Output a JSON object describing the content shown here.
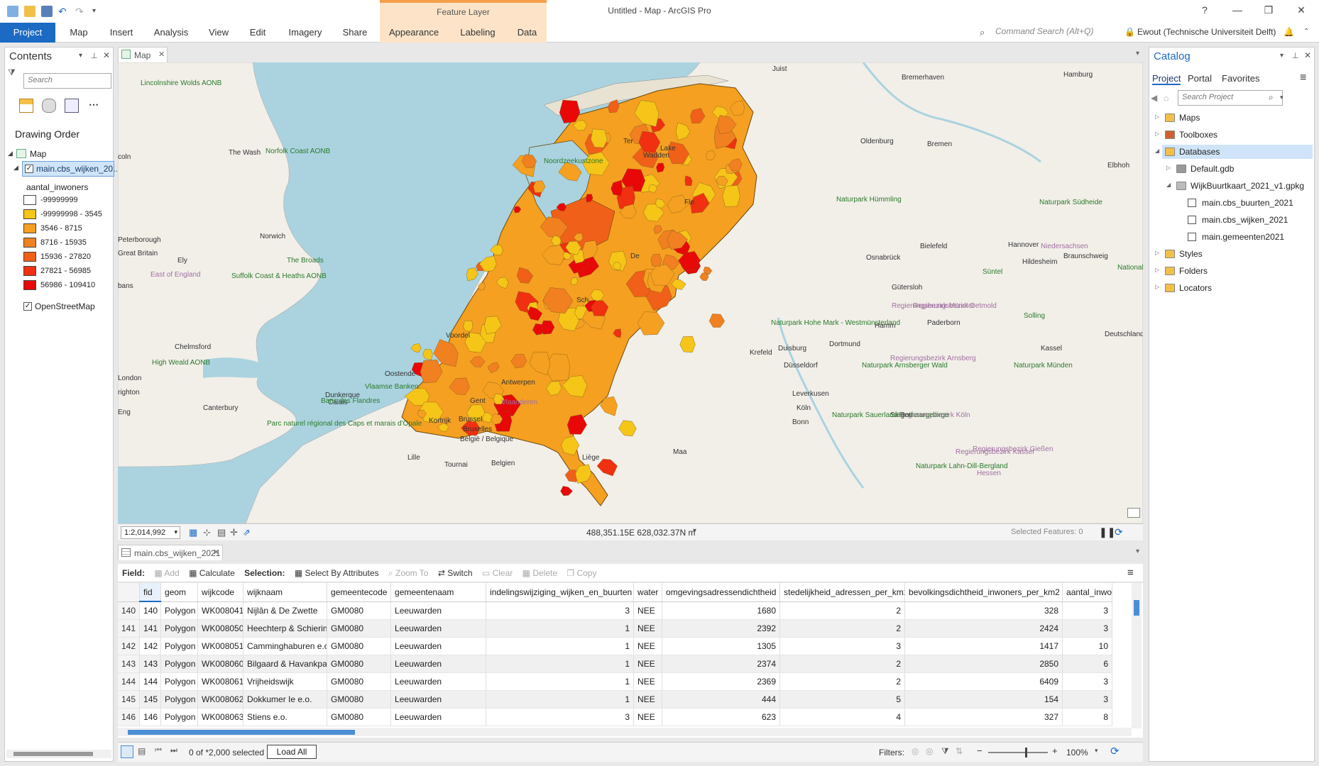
{
  "window": {
    "title": "Untitled - Map - ArcGIS Pro",
    "context_tab_header": "Feature Layer",
    "help": "?",
    "minimize": "—",
    "maximize": "❐",
    "close": "✕"
  },
  "ribbon": {
    "tabs": [
      "Project",
      "Map",
      "Insert",
      "Analysis",
      "View",
      "Edit",
      "Imagery",
      "Share",
      "Appearance",
      "Labeling",
      "Data"
    ],
    "command_search_placeholder": "Command Search (Alt+Q)",
    "user": "Ewout (Technische Universiteit Delft)"
  },
  "contents": {
    "title": "Contents",
    "search_placeholder": "Search",
    "section": "Drawing Order",
    "map_item": "Map",
    "layer_name": "main.cbs_wijken_20...",
    "field_name": "aantal_inwoners",
    "legend": [
      {
        "label": "-99999999",
        "color": "#ffffff"
      },
      {
        "label": "-99999998 - 3545",
        "color": "#f5c518"
      },
      {
        "label": "3546 - 8715",
        "color": "#f5a020"
      },
      {
        "label": "8716 - 15935",
        "color": "#f08020"
      },
      {
        "label": "15936 - 27820",
        "color": "#f06018"
      },
      {
        "label": "27821 - 56985",
        "color": "#f03010"
      },
      {
        "label": "56986 - 109410",
        "color": "#e80808"
      }
    ],
    "basemap": "OpenStreetMap"
  },
  "map": {
    "tab_label": "Map",
    "scale": "1:2,014,992",
    "coordinates": "488,351.15E 628,032.37N m",
    "selected_features": "Selected Features: 0",
    "place_labels": [
      {
        "text": "Bremerhaven"
      },
      {
        "text": "Hamburg"
      },
      {
        "text": "Oldenburg"
      },
      {
        "text": "Bremen"
      },
      {
        "text": "Hannover"
      },
      {
        "text": "Osnabrück"
      },
      {
        "text": "Bielefeld"
      },
      {
        "text": "Hildesheim"
      },
      {
        "text": "Braunschweig"
      },
      {
        "text": "Gütersloh"
      },
      {
        "text": "Paderborn"
      },
      {
        "text": "Hamm"
      },
      {
        "text": "Dortmund"
      },
      {
        "text": "Duisburg"
      },
      {
        "text": "Krefeld"
      },
      {
        "text": "Düsseldorf"
      },
      {
        "text": "Kassel"
      },
      {
        "text": "Deutschland"
      },
      {
        "text": "Leverkusen"
      },
      {
        "text": "Köln"
      },
      {
        "text": "Bonn"
      },
      {
        "text": "Siegen"
      },
      {
        "text": "Antwerpen"
      },
      {
        "text": "Gent"
      },
      {
        "text": "Oostende"
      },
      {
        "text": "Brussel"
      },
      {
        "text": "Bruxelles"
      },
      {
        "text": "België / Belgique"
      },
      {
        "text": "Belgien"
      },
      {
        "text": "Liège"
      },
      {
        "text": "Kortrijk"
      },
      {
        "text": "Lille"
      },
      {
        "text": "Tournai"
      },
      {
        "text": "Calais"
      },
      {
        "text": "Dunkerque"
      },
      {
        "text": "London"
      },
      {
        "text": "Chelmsford"
      },
      {
        "text": "Canterbury"
      },
      {
        "text": "Norwich"
      },
      {
        "text": "Ely"
      },
      {
        "text": "Peterborough"
      },
      {
        "text": "Great Britain"
      },
      {
        "text": "Juist"
      },
      {
        "text": "Noordzeekustzone"
      },
      {
        "text": "Vlaanderen"
      },
      {
        "text": "Niedersachsen"
      },
      {
        "text": "Hessen"
      },
      {
        "text": "Regierungsbezirk Münster"
      },
      {
        "text": "Regierungsbezirk Detmold"
      },
      {
        "text": "Regierungsbezirk Arnsberg"
      },
      {
        "text": "Regierungsbezirk Köln"
      },
      {
        "text": "Regierungsbezirk Kassel"
      },
      {
        "text": "Regierungsbezirk Gießen"
      },
      {
        "text": "Naturpark Hümmling"
      },
      {
        "text": "Naturpark Südheide"
      },
      {
        "text": "Naturpark Hohe Mark - Westmünsterland"
      },
      {
        "text": "Naturpark Arnsberger Wald"
      },
      {
        "text": "Naturpark Sauerland-Rothaargebirge"
      },
      {
        "text": "Naturpark Lahn-Dill-Bergland"
      },
      {
        "text": "Naturpark Münden"
      },
      {
        "text": "Lincolnshire Wolds AONB"
      },
      {
        "text": "Norfolk Coast AONB"
      },
      {
        "text": "The Broads"
      },
      {
        "text": "Suffolk Coast & Heaths AONB"
      },
      {
        "text": "High Weald AONB"
      },
      {
        "text": "Vlaamse Banken"
      },
      {
        "text": "Banc des Flandres"
      },
      {
        "text": "Parc naturel régional des Caps et marais d'Opale"
      },
      {
        "text": "East of England"
      },
      {
        "text": "Solling"
      },
      {
        "text": "Süntel"
      },
      {
        "text": "Maa"
      },
      {
        "text": "Fle"
      },
      {
        "text": "De"
      },
      {
        "text": "Sch"
      },
      {
        "text": "Voordel"
      },
      {
        "text": "bans"
      },
      {
        "text": "coln"
      },
      {
        "text": "Eng"
      },
      {
        "text": "righton"
      },
      {
        "text": "Elbhoh"
      },
      {
        "text": "Nationalpar Harz"
      },
      {
        "text": "Ter"
      },
      {
        "text": "Wadden"
      },
      {
        "text": "Lake"
      },
      {
        "text": "The Wash"
      }
    ]
  },
  "attribute_table": {
    "tab_label": "main.cbs_wijken_2021",
    "toolbar": {
      "field_label": "Field:",
      "add": "Add",
      "calculate": "Calculate",
      "selection_label": "Selection:",
      "select_by_attributes": "Select By Attributes",
      "zoom_to": "Zoom To",
      "switch": "Switch",
      "clear": "Clear",
      "delete": "Delete",
      "copy": "Copy"
    },
    "columns": [
      "fid",
      "geom",
      "wijkcode",
      "wijknaam",
      "gemeentecode",
      "gemeentenaam",
      "indelingswijziging_wijken_en_buurten",
      "water",
      "omgevingsadressendichtheid",
      "stedelijkheid_adressen_per_km2",
      "bevolkingsdichtheid_inwoners_per_km2",
      "aantal_inwo"
    ],
    "rows": [
      {
        "row": "140",
        "fid": "140",
        "geom": "Polygon",
        "wijkcode": "WK008041",
        "wijknaam": "Nijlân & De Zwette",
        "gemeentecode": "GM0080",
        "gemeentenaam": "Leeuwarden",
        "indeling": "3",
        "water": "NEE",
        "omgeving": "1680",
        "stedelijkheid": "2",
        "bevolking": "328",
        "aantal": "3"
      },
      {
        "row": "141",
        "fid": "141",
        "geom": "Polygon",
        "wijkcode": "WK008050",
        "wijknaam": "Heechterp & Schieringe",
        "gemeentecode": "GM0080",
        "gemeentenaam": "Leeuwarden",
        "indeling": "1",
        "water": "NEE",
        "omgeving": "2392",
        "stedelijkheid": "2",
        "bevolking": "2424",
        "aantal": "3"
      },
      {
        "row": "142",
        "fid": "142",
        "geom": "Polygon",
        "wijkcode": "WK008051",
        "wijknaam": "Camminghaburen e.o.",
        "gemeentecode": "GM0080",
        "gemeentenaam": "Leeuwarden",
        "indeling": "1",
        "water": "NEE",
        "omgeving": "1305",
        "stedelijkheid": "3",
        "bevolking": "1417",
        "aantal": "10"
      },
      {
        "row": "143",
        "fid": "143",
        "geom": "Polygon",
        "wijkcode": "WK008060",
        "wijknaam": "Bilgaard & Havankpark",
        "gemeentecode": "GM0080",
        "gemeentenaam": "Leeuwarden",
        "indeling": "1",
        "water": "NEE",
        "omgeving": "2374",
        "stedelijkheid": "2",
        "bevolking": "2850",
        "aantal": "6"
      },
      {
        "row": "144",
        "fid": "144",
        "geom": "Polygon",
        "wijkcode": "WK008061",
        "wijknaam": "Vrijheidswijk",
        "gemeentecode": "GM0080",
        "gemeentenaam": "Leeuwarden",
        "indeling": "1",
        "water": "NEE",
        "omgeving": "2369",
        "stedelijkheid": "2",
        "bevolking": "6409",
        "aantal": "3"
      },
      {
        "row": "145",
        "fid": "145",
        "geom": "Polygon",
        "wijkcode": "WK008062",
        "wijknaam": "Dokkumer Ie e.o.",
        "gemeentecode": "GM0080",
        "gemeentenaam": "Leeuwarden",
        "indeling": "1",
        "water": "NEE",
        "omgeving": "444",
        "stedelijkheid": "5",
        "bevolking": "154",
        "aantal": "3"
      },
      {
        "row": "146",
        "fid": "146",
        "geom": "Polygon",
        "wijkcode": "WK008063",
        "wijknaam": "Stiens e.o.",
        "gemeentecode": "GM0080",
        "gemeentenaam": "Leeuwarden",
        "indeling": "3",
        "water": "NEE",
        "omgeving": "623",
        "stedelijkheid": "4",
        "bevolking": "327",
        "aantal": "8"
      }
    ],
    "footer": {
      "selected": "0 of *2,000 selected",
      "load_all": "Load All",
      "filters": "Filters:",
      "zoom": "100%"
    }
  },
  "catalog": {
    "title": "Catalog",
    "tabs": [
      "Project",
      "Portal",
      "Favorites"
    ],
    "search_placeholder": "Search Project",
    "items": [
      {
        "label": "Maps",
        "icon": "maps-folder-icon"
      },
      {
        "label": "Toolboxes",
        "icon": "toolbox-icon"
      },
      {
        "label": "Databases",
        "icon": "database-folder-icon"
      },
      {
        "label": "Default.gdb",
        "icon": "geodatabase-icon"
      },
      {
        "label": "WijkBuurtkaart_2021_v1.gpkg",
        "icon": "geopackage-icon"
      },
      {
        "label": "main.cbs_buurten_2021",
        "icon": "table-icon"
      },
      {
        "label": "main.cbs_wijken_2021",
        "icon": "table-icon"
      },
      {
        "label": "main.gemeenten2021",
        "icon": "table-icon"
      },
      {
        "label": "Styles",
        "icon": "styles-folder-icon"
      },
      {
        "label": "Folders",
        "icon": "folder-icon"
      },
      {
        "label": "Locators",
        "icon": "locator-icon"
      }
    ]
  },
  "colors": {
    "accent": "#1b6ac4",
    "context_tab": "#fde4c8",
    "context_tab_border": "#f5a04a",
    "water": "#aad3df",
    "land": "#f2efe9"
  }
}
